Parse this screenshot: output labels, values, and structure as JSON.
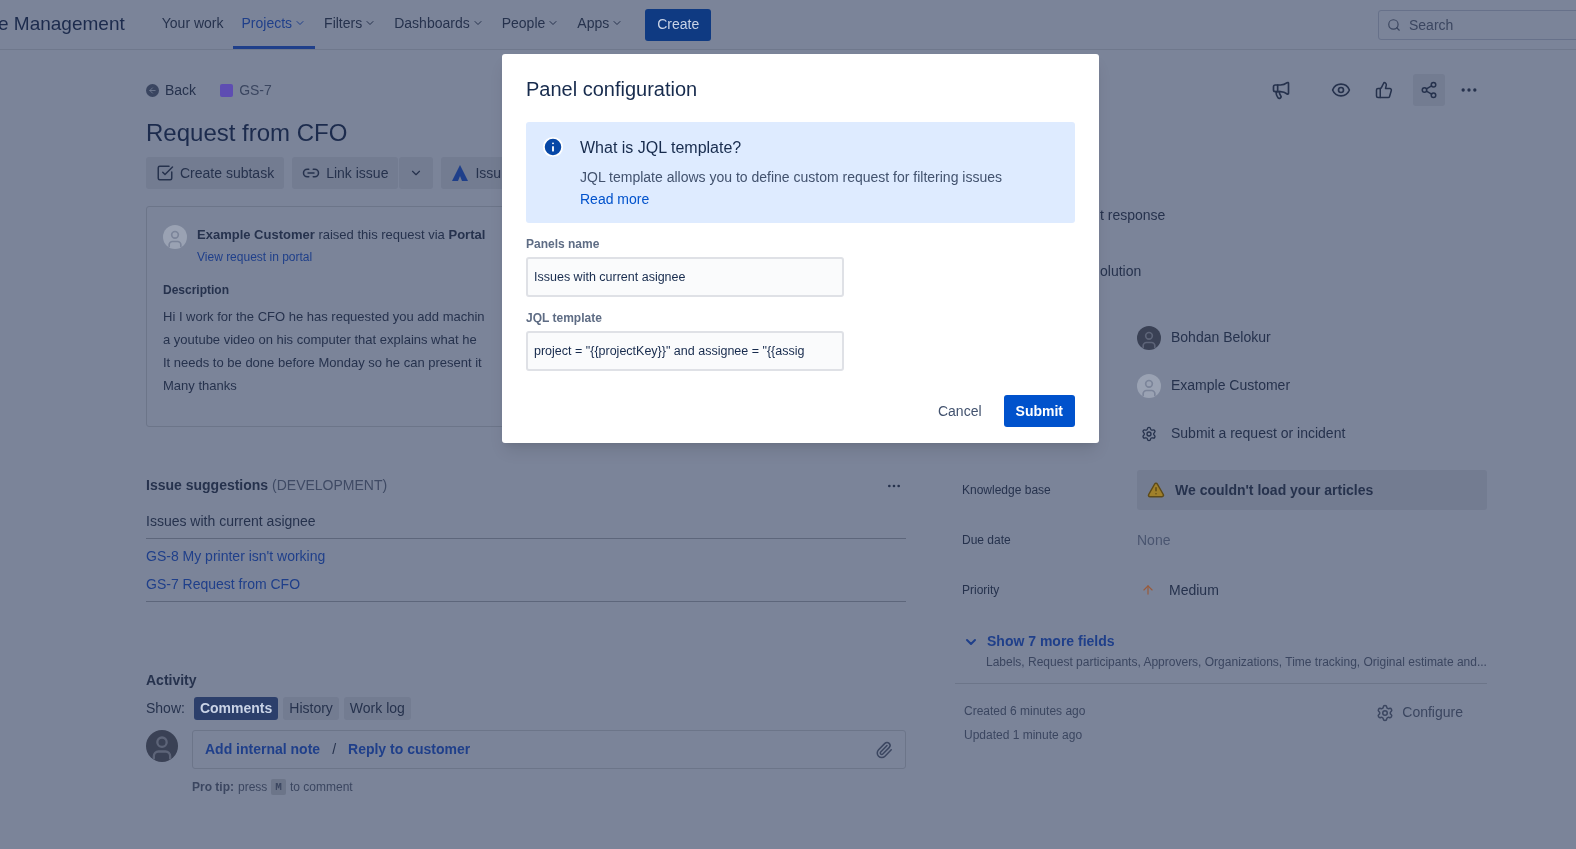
{
  "header": {
    "logo": "e Management",
    "nav": [
      {
        "label": "Your work",
        "dropdown": false,
        "selected": false
      },
      {
        "label": "Projects",
        "dropdown": true,
        "selected": true
      },
      {
        "label": "Filters",
        "dropdown": true,
        "selected": false
      },
      {
        "label": "Dashboards",
        "dropdown": true,
        "selected": false
      },
      {
        "label": "People",
        "dropdown": true,
        "selected": false
      },
      {
        "label": "Apps",
        "dropdown": true,
        "selected": false
      }
    ],
    "create": "Create",
    "search": {
      "placeholder": "Search"
    }
  },
  "breadcrumb": {
    "back": "Back",
    "issue_key": "GS-7"
  },
  "title": "Request from CFO",
  "actions": [
    {
      "kind": "subtask",
      "label": "Create subtask"
    },
    {
      "kind": "link",
      "label": "Link issue"
    },
    {
      "kind": "app",
      "label": "Issu"
    }
  ],
  "request": {
    "customer": "Example Customer",
    "via": "raised this request via",
    "channel": "Portal",
    "portal_link": "View request in portal",
    "description_label": "Description",
    "lines": [
      "Hi I work for the CFO he has requested you add machin",
      "a youtube video on his computer that explains what he",
      "It needs to be done before Monday so he can present it",
      "Many thanks"
    ]
  },
  "suggestions": {
    "title": "Issue suggestions",
    "tag": "(DEVELOPMENT)",
    "panel": "Issues with current asignee",
    "issues": [
      "GS-8 My printer isn't working",
      "GS-7 Request from CFO"
    ]
  },
  "activity": {
    "title": "Activity",
    "show": "Show:",
    "tabs": [
      {
        "label": "Comments",
        "selected": true
      },
      {
        "label": "History",
        "selected": false
      },
      {
        "label": "Work log",
        "selected": false
      }
    ],
    "note": "Add internal note",
    "separator": "/",
    "reply": "Reply to customer",
    "tip_label": "Pro tip:",
    "tip_press": "press",
    "tip_key": "M",
    "tip_rest": "to comment"
  },
  "sla": [
    "t response",
    "olution"
  ],
  "people": [
    {
      "kind": "photo",
      "name": "Bohdan Belokur"
    },
    {
      "kind": "avatar",
      "name": "Example Customer"
    },
    {
      "kind": "request-type",
      "name": "Submit a request or incident"
    }
  ],
  "fields": [
    {
      "kind": "warning",
      "label": "Knowledge base",
      "value": "We couldn't load your articles"
    },
    {
      "kind": "muted",
      "label": "Due date",
      "value": "None"
    },
    {
      "kind": "priority",
      "label": "Priority",
      "value": "Medium"
    }
  ],
  "more": {
    "link": "Show 7 more fields",
    "list": "Labels, Request participants, Approvers, Organizations, Time tracking, Original estimate and..."
  },
  "meta": {
    "created": "Created 6 minutes ago",
    "updated": "Updated 1 minute ago",
    "configure": "Configure"
  },
  "modal": {
    "title": "Panel configuration",
    "info": {
      "title": "What is JQL template?",
      "text": "JQL template allows you to define custom request for filtering issues",
      "link": "Read more"
    },
    "fields": [
      {
        "label": "Panels name",
        "value": "Issues with current asignee"
      },
      {
        "label": "JQL template",
        "value": "project = \"{{projectKey}}\" and assignee = \"{{assig"
      }
    ],
    "cancel": "Cancel",
    "submit": "Submit"
  }
}
